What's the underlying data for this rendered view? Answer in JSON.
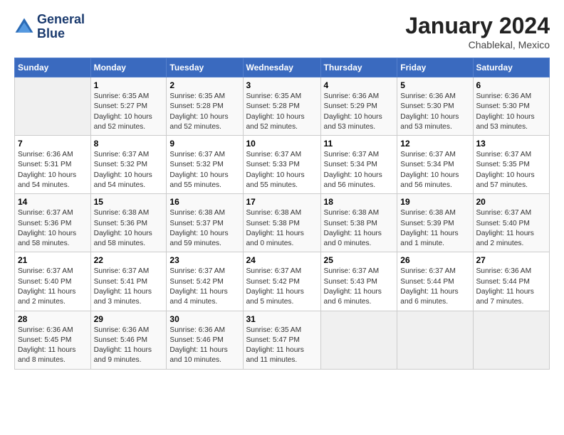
{
  "logo": {
    "line1": "General",
    "line2": "Blue"
  },
  "title": "January 2024",
  "subtitle": "Chablekal, Mexico",
  "header_days": [
    "Sunday",
    "Monday",
    "Tuesday",
    "Wednesday",
    "Thursday",
    "Friday",
    "Saturday"
  ],
  "weeks": [
    [
      {
        "day": "",
        "info": ""
      },
      {
        "day": "1",
        "info": "Sunrise: 6:35 AM\nSunset: 5:27 PM\nDaylight: 10 hours\nand 52 minutes."
      },
      {
        "day": "2",
        "info": "Sunrise: 6:35 AM\nSunset: 5:28 PM\nDaylight: 10 hours\nand 52 minutes."
      },
      {
        "day": "3",
        "info": "Sunrise: 6:35 AM\nSunset: 5:28 PM\nDaylight: 10 hours\nand 52 minutes."
      },
      {
        "day": "4",
        "info": "Sunrise: 6:36 AM\nSunset: 5:29 PM\nDaylight: 10 hours\nand 53 minutes."
      },
      {
        "day": "5",
        "info": "Sunrise: 6:36 AM\nSunset: 5:30 PM\nDaylight: 10 hours\nand 53 minutes."
      },
      {
        "day": "6",
        "info": "Sunrise: 6:36 AM\nSunset: 5:30 PM\nDaylight: 10 hours\nand 53 minutes."
      }
    ],
    [
      {
        "day": "7",
        "info": "Sunrise: 6:36 AM\nSunset: 5:31 PM\nDaylight: 10 hours\nand 54 minutes."
      },
      {
        "day": "8",
        "info": "Sunrise: 6:37 AM\nSunset: 5:32 PM\nDaylight: 10 hours\nand 54 minutes."
      },
      {
        "day": "9",
        "info": "Sunrise: 6:37 AM\nSunset: 5:32 PM\nDaylight: 10 hours\nand 55 minutes."
      },
      {
        "day": "10",
        "info": "Sunrise: 6:37 AM\nSunset: 5:33 PM\nDaylight: 10 hours\nand 55 minutes."
      },
      {
        "day": "11",
        "info": "Sunrise: 6:37 AM\nSunset: 5:34 PM\nDaylight: 10 hours\nand 56 minutes."
      },
      {
        "day": "12",
        "info": "Sunrise: 6:37 AM\nSunset: 5:34 PM\nDaylight: 10 hours\nand 56 minutes."
      },
      {
        "day": "13",
        "info": "Sunrise: 6:37 AM\nSunset: 5:35 PM\nDaylight: 10 hours\nand 57 minutes."
      }
    ],
    [
      {
        "day": "14",
        "info": "Sunrise: 6:37 AM\nSunset: 5:36 PM\nDaylight: 10 hours\nand 58 minutes."
      },
      {
        "day": "15",
        "info": "Sunrise: 6:38 AM\nSunset: 5:36 PM\nDaylight: 10 hours\nand 58 minutes."
      },
      {
        "day": "16",
        "info": "Sunrise: 6:38 AM\nSunset: 5:37 PM\nDaylight: 10 hours\nand 59 minutes."
      },
      {
        "day": "17",
        "info": "Sunrise: 6:38 AM\nSunset: 5:38 PM\nDaylight: 11 hours\nand 0 minutes."
      },
      {
        "day": "18",
        "info": "Sunrise: 6:38 AM\nSunset: 5:38 PM\nDaylight: 11 hours\nand 0 minutes."
      },
      {
        "day": "19",
        "info": "Sunrise: 6:38 AM\nSunset: 5:39 PM\nDaylight: 11 hours\nand 1 minute."
      },
      {
        "day": "20",
        "info": "Sunrise: 6:37 AM\nSunset: 5:40 PM\nDaylight: 11 hours\nand 2 minutes."
      }
    ],
    [
      {
        "day": "21",
        "info": "Sunrise: 6:37 AM\nSunset: 5:40 PM\nDaylight: 11 hours\nand 2 minutes."
      },
      {
        "day": "22",
        "info": "Sunrise: 6:37 AM\nSunset: 5:41 PM\nDaylight: 11 hours\nand 3 minutes."
      },
      {
        "day": "23",
        "info": "Sunrise: 6:37 AM\nSunset: 5:42 PM\nDaylight: 11 hours\nand 4 minutes."
      },
      {
        "day": "24",
        "info": "Sunrise: 6:37 AM\nSunset: 5:42 PM\nDaylight: 11 hours\nand 5 minutes."
      },
      {
        "day": "25",
        "info": "Sunrise: 6:37 AM\nSunset: 5:43 PM\nDaylight: 11 hours\nand 6 minutes."
      },
      {
        "day": "26",
        "info": "Sunrise: 6:37 AM\nSunset: 5:44 PM\nDaylight: 11 hours\nand 6 minutes."
      },
      {
        "day": "27",
        "info": "Sunrise: 6:36 AM\nSunset: 5:44 PM\nDaylight: 11 hours\nand 7 minutes."
      }
    ],
    [
      {
        "day": "28",
        "info": "Sunrise: 6:36 AM\nSunset: 5:45 PM\nDaylight: 11 hours\nand 8 minutes."
      },
      {
        "day": "29",
        "info": "Sunrise: 6:36 AM\nSunset: 5:46 PM\nDaylight: 11 hours\nand 9 minutes."
      },
      {
        "day": "30",
        "info": "Sunrise: 6:36 AM\nSunset: 5:46 PM\nDaylight: 11 hours\nand 10 minutes."
      },
      {
        "day": "31",
        "info": "Sunrise: 6:35 AM\nSunset: 5:47 PM\nDaylight: 11 hours\nand 11 minutes."
      },
      {
        "day": "",
        "info": ""
      },
      {
        "day": "",
        "info": ""
      },
      {
        "day": "",
        "info": ""
      }
    ]
  ]
}
